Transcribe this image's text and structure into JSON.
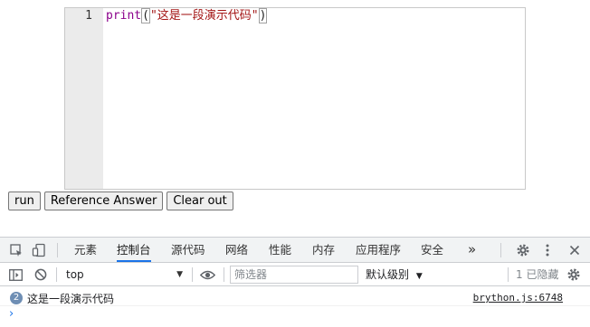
{
  "editor": {
    "line_number": "1",
    "code": {
      "fn": "print",
      "open_paren": "(",
      "string": "\"这是一段演示代码\"",
      "close_paren": ")"
    }
  },
  "buttons": {
    "run": "run",
    "reference": "Reference Answer",
    "clear": "Clear out"
  },
  "devtools": {
    "tabs": [
      "元素",
      "控制台",
      "源代码",
      "网络",
      "性能",
      "内存",
      "应用程序",
      "安全"
    ],
    "active_tab": "控制台",
    "more": "»",
    "context": "top",
    "filter_placeholder": "筛选器",
    "levels": "默认级别",
    "hidden": "1 已隐藏",
    "icons": [
      "inspect-icon",
      "device-toggle-icon",
      "gear-icon",
      "kebab-menu-icon",
      "close-icon",
      "sidebar-icon",
      "clear-console-icon",
      "eye-icon",
      "settings-icon"
    ]
  },
  "console": {
    "count": "2",
    "message": "这是一段演示代码",
    "source": "brython.js:6748",
    "prompt": "›"
  },
  "colors": {
    "accent": "#1a73e8",
    "keyword": "#8b008b",
    "string": "#a31515"
  }
}
